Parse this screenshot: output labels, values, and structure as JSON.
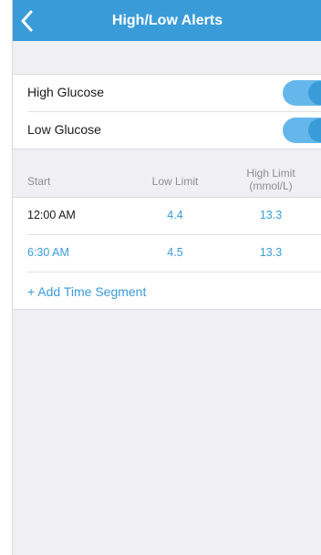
{
  "header": {
    "title": "High/Low Alerts",
    "back_icon": "chevron-left-icon"
  },
  "alerts": [
    {
      "label": "High Glucose",
      "enabled": true
    },
    {
      "label": "Low Glucose",
      "enabled": true
    }
  ],
  "table": {
    "headers": {
      "start": "Start",
      "low": "Low Limit",
      "high_line1": "High Limit",
      "high_line2": "(mmol/L)"
    },
    "rows": [
      {
        "start": "12:00 AM",
        "low": "4.4",
        "high": "13.3",
        "start_color": "#1a1a1a"
      },
      {
        "start": "6:30 AM",
        "low": "4.5",
        "high": "13.3",
        "start_color": "#3a9bd9"
      }
    ]
  },
  "add_segment_label": "+ Add Time Segment",
  "colors": {
    "accent": "#3a9bd9",
    "switch_track": "#65b7eb",
    "background": "#efeff4"
  }
}
